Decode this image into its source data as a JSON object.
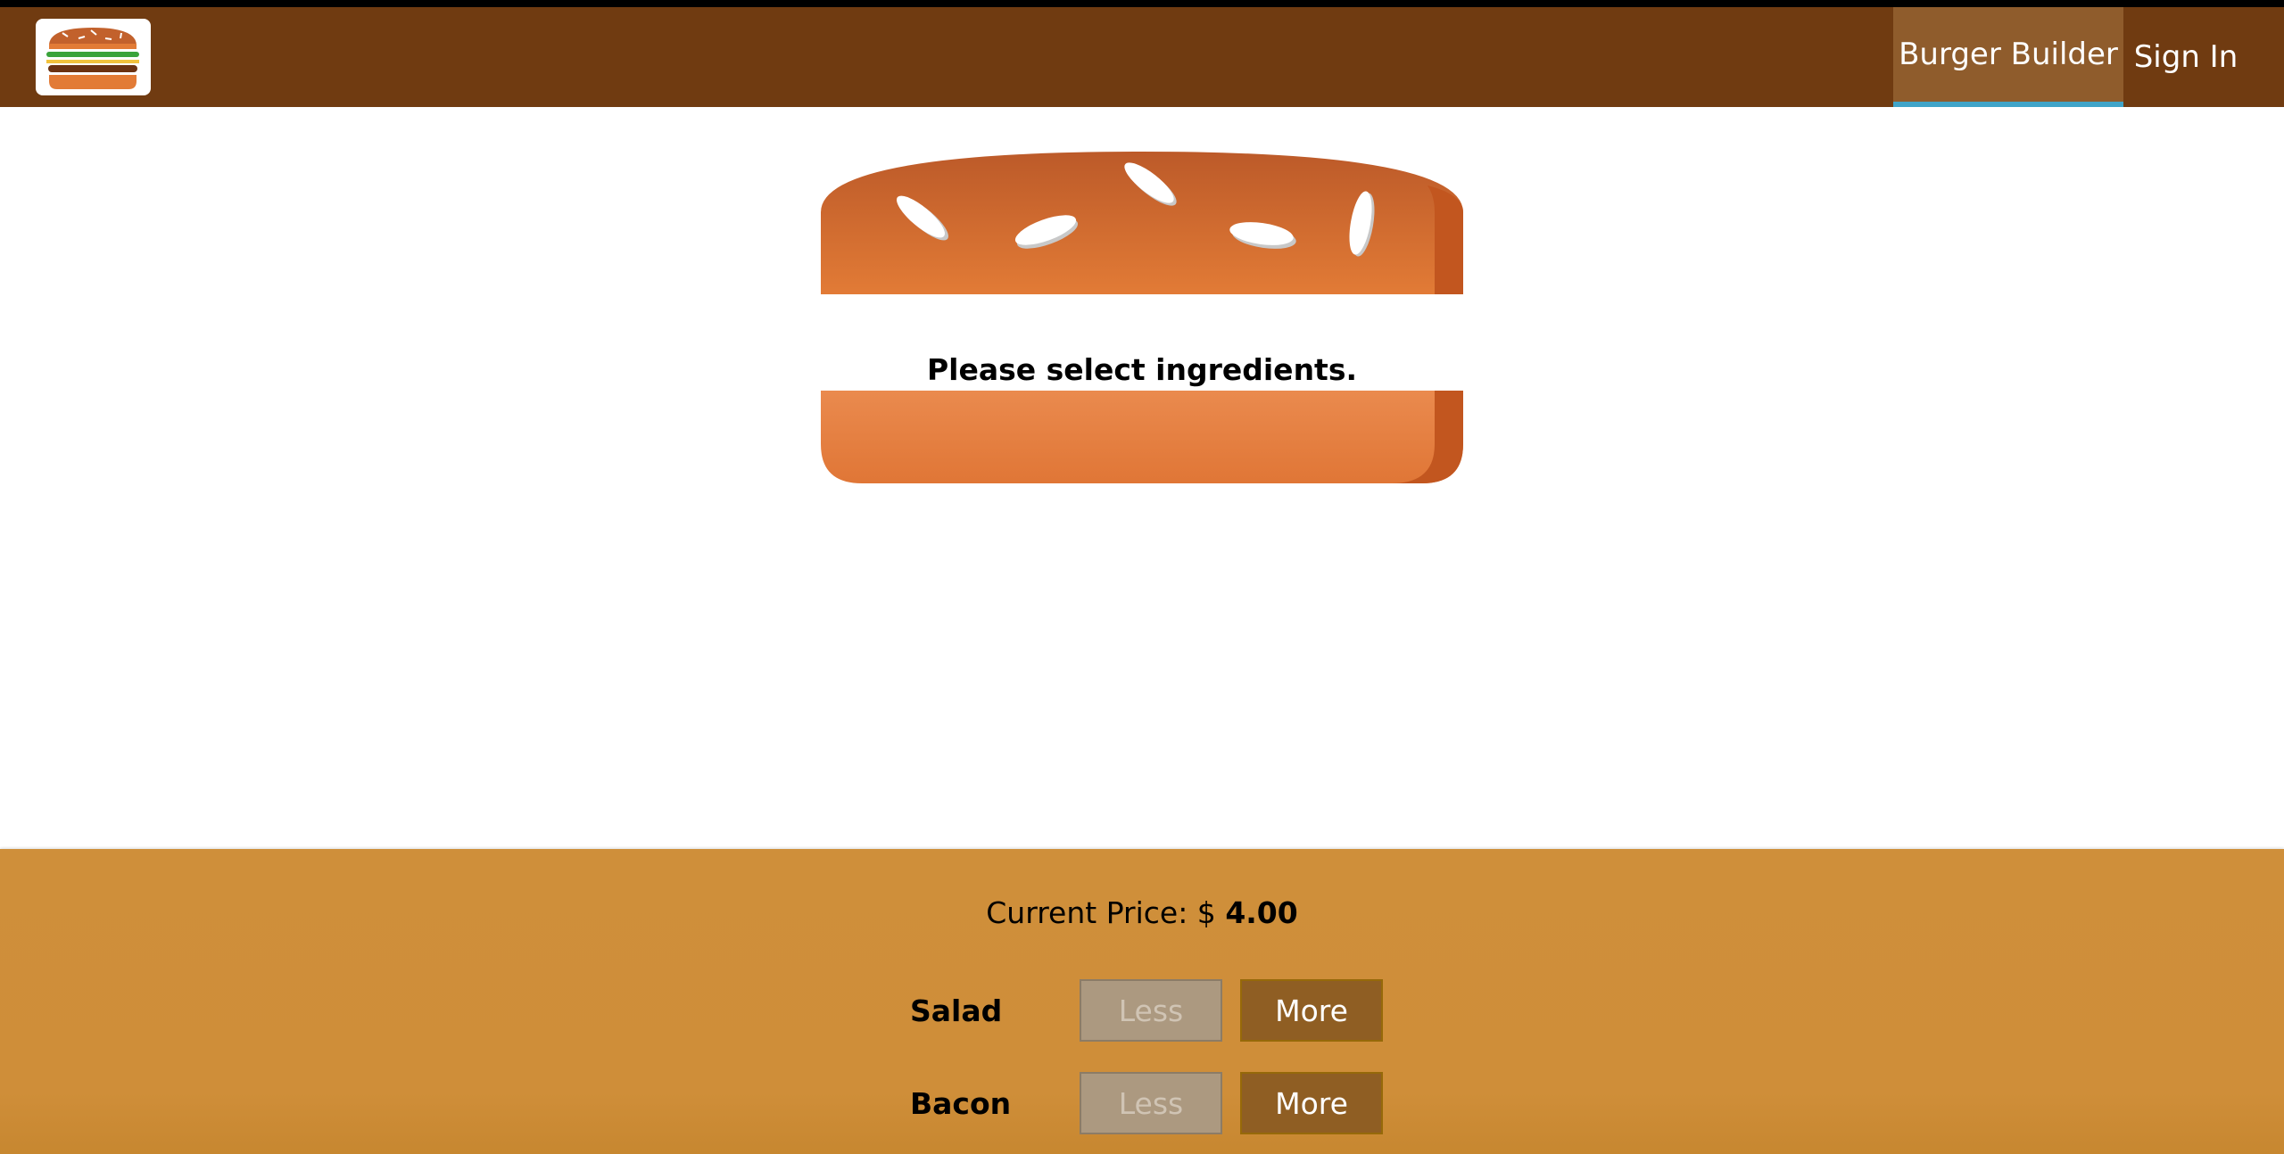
{
  "app": {
    "logo_alt": "MyBurger",
    "colors": {
      "toolbar": "#703b11",
      "active_tab": "#8f5c2c",
      "active_indicator": "#40a4c8",
      "controls_bg": "#cf8f3a",
      "bun": "#e27b36",
      "more_button": "#8f5e23",
      "less_button_disabled": "#ac9980"
    }
  },
  "nav": {
    "items": [
      {
        "label": "Burger Builder",
        "active": true
      },
      {
        "label": "Sign In",
        "active": false
      }
    ]
  },
  "burger": {
    "message": "Please select ingredients."
  },
  "controls": {
    "price_label": "Current Price: $",
    "price_value": "4.00",
    "ingredients": [
      {
        "label": "Salad",
        "less_label": "Less",
        "more_label": "More",
        "less_disabled": true
      },
      {
        "label": "Bacon",
        "less_label": "Less",
        "more_label": "More",
        "less_disabled": true
      }
    ]
  }
}
